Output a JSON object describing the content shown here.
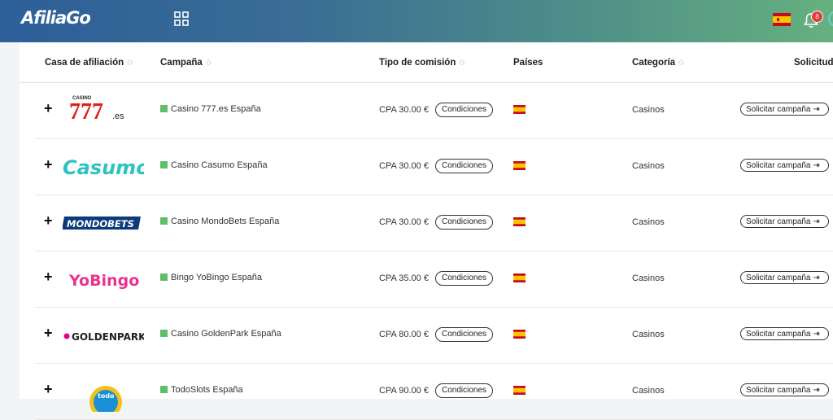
{
  "header": {
    "logo_text": "AfiliaGo",
    "notification_count": "8",
    "gradient_start": "#2d5f99",
    "gradient_end": "#66b07f"
  },
  "table": {
    "columns": [
      "Casa de afiliación",
      "Campaña",
      "Tipo de comisión",
      "Países",
      "Categoría",
      "Solicitud"
    ],
    "condiciones_label": "Condiciones",
    "solicitar_label": "Solicitar campaña",
    "rows": [
      {
        "brand": "777.es",
        "logo_small": "CASINO",
        "logo_main": "777",
        "logo_suffix": ".es",
        "campaign": "Casino 777.es España",
        "commission": "CPA 30.00 €",
        "category": "Casinos"
      },
      {
        "brand": "Casumo",
        "logo_main": "Casumo",
        "campaign": "Casino Casumo España",
        "commission": "CPA 30.00 €",
        "category": "Casinos"
      },
      {
        "brand": "MondoBets",
        "logo_main": "MONDOBETS",
        "campaign": "Casino MondoBets España",
        "commission": "CPA 30.00 €",
        "category": "Casinos"
      },
      {
        "brand": "YoBingo",
        "logo_main": "YoBingo",
        "campaign": "Bingo YoBingo España",
        "commission": "CPA 35.00 €",
        "category": "Casinos"
      },
      {
        "brand": "GoldenPark",
        "logo_main": "GOLDENPARK",
        "campaign": "Casino GoldenPark España",
        "commission": "CPA 80.00 €",
        "category": "Casinos"
      },
      {
        "brand": "TodoSlots",
        "logo_main": "todo",
        "campaign": "TodoSlots España",
        "commission": "CPA 90.00 €",
        "category": "Casinos"
      }
    ]
  }
}
